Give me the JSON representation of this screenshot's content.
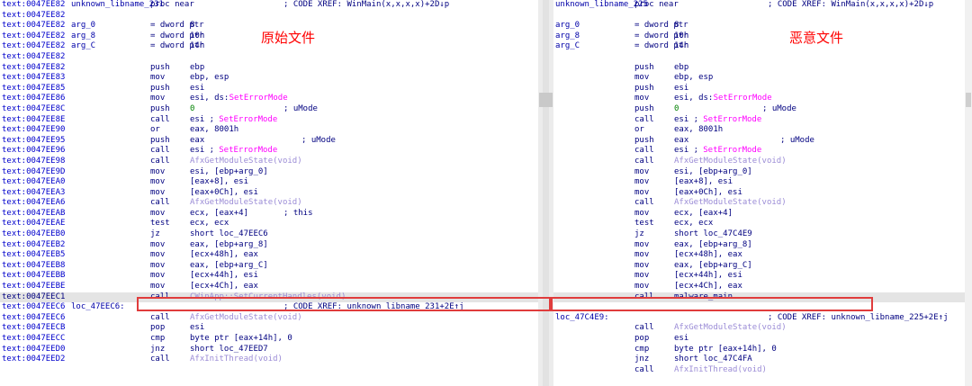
{
  "labels": {
    "left_title": "原始文件",
    "right_title": "恶意文件"
  },
  "left_lines": [
    {
      "addr": "text:0047EE82",
      "label": "unknown_libname_231",
      "mn": "proc near",
      "cm": "; CODE XREF: WinMain(x,x,x,x)+2D↓p"
    },
    {
      "addr": "text:0047EE82"
    },
    {
      "addr": "text:0047EE82",
      "label": "arg_0",
      "mn": "= dword ptr",
      "op": "8"
    },
    {
      "addr": "text:0047EE82",
      "label": "arg_8",
      "mn": "= dword ptr",
      "op": "10h"
    },
    {
      "addr": "text:0047EE82",
      "label": "arg_C",
      "mn": "= dword ptr",
      "op": "14h"
    },
    {
      "addr": "text:0047EE82"
    },
    {
      "addr": "text:0047EE82",
      "mn": "push",
      "op": "ebp"
    },
    {
      "addr": "text:0047EE83",
      "mn": "mov",
      "op": "ebp, esp"
    },
    {
      "addr": "text:0047EE85",
      "mn": "push",
      "op": "esi"
    },
    {
      "addr": "text:0047EE86",
      "mn": "mov",
      "op": "esi, ds:",
      "sym": "SetErrorMode"
    },
    {
      "addr": "text:0047EE8C",
      "mn": "push",
      "num": "0",
      "cm": "; uMode"
    },
    {
      "addr": "text:0047EE8E",
      "mn": "call",
      "op": "esi ;",
      "sym": "SetErrorMode"
    },
    {
      "addr": "text:0047EE90",
      "mn": "or",
      "op": "eax, 8001h"
    },
    {
      "addr": "text:0047EE95",
      "mn": "push",
      "op": "eax",
      "cm": "; uMode"
    },
    {
      "addr": "text:0047EE96",
      "mn": "call",
      "op": "esi ;",
      "sym": "SetErrorMode"
    },
    {
      "addr": "text:0047EE98",
      "mn": "call",
      "fn": "AfxGetModuleState(void)"
    },
    {
      "addr": "text:0047EE9D",
      "mn": "mov",
      "op": "esi, [ebp+arg_0]"
    },
    {
      "addr": "text:0047EEA0",
      "mn": "mov",
      "op": "[eax+8], esi"
    },
    {
      "addr": "text:0047EEA3",
      "mn": "mov",
      "op": "[eax+0Ch], esi"
    },
    {
      "addr": "text:0047EEA6",
      "mn": "call",
      "fn": "AfxGetModuleState(void)"
    },
    {
      "addr": "text:0047EEAB",
      "mn": "mov",
      "op": "ecx, [eax+4]",
      "cm": "; this"
    },
    {
      "addr": "text:0047EEAE",
      "mn": "test",
      "op": "ecx, ecx"
    },
    {
      "addr": "text:0047EEB0",
      "mn": "jz",
      "op": "short loc_47EEC6"
    },
    {
      "addr": "text:0047EEB2",
      "mn": "mov",
      "op": "eax, [ebp+arg_8]"
    },
    {
      "addr": "text:0047EEB5",
      "mn": "mov",
      "op": "[ecx+48h], eax"
    },
    {
      "addr": "text:0047EEB8",
      "mn": "mov",
      "op": "eax, [ebp+arg_C]"
    },
    {
      "addr": "text:0047EEBB",
      "mn": "mov",
      "op": "[ecx+44h], esi"
    },
    {
      "addr": "text:0047EEBE",
      "mn": "mov",
      "op": "[ecx+4Ch], eax"
    },
    {
      "addr": "text:0047EEC1",
      "mn": "call",
      "fn": "CWinApp::SetCurrentHandles(void)",
      "hl": true
    },
    {
      "addr": "text:0047EEC6",
      "label": "loc_47EEC6:",
      "cm": "; CODE XREF: unknown_libname_231+2E↑j"
    },
    {
      "addr": "text:0047EEC6",
      "mn": "call",
      "fn": "AfxGetModuleState(void)"
    },
    {
      "addr": "text:0047EECB",
      "mn": "pop",
      "op": "esi"
    },
    {
      "addr": "text:0047EECC",
      "mn": "cmp",
      "op": "byte ptr [eax+14h], 0"
    },
    {
      "addr": "text:0047EED0",
      "mn": "jnz",
      "op": "short loc_47EED7"
    },
    {
      "addr": "text:0047EED2",
      "mn": "call",
      "fn": "AfxInitThread(void)"
    }
  ],
  "right_lines": [
    {
      "label": "unknown_libname_225",
      "mn": "proc near",
      "cm": "; CODE XREF: WinMain(x,x,x,x)+2D↓p"
    },
    {},
    {
      "label": "arg_0",
      "mn": "= dword ptr",
      "op": "8"
    },
    {
      "label": "arg_8",
      "mn": "= dword ptr",
      "op": "10h"
    },
    {
      "label": "arg_C",
      "mn": "= dword ptr",
      "op": "14h"
    },
    {},
    {
      "mn": "push",
      "op": "ebp"
    },
    {
      "mn": "mov",
      "op": "ebp, esp"
    },
    {
      "mn": "push",
      "op": "esi"
    },
    {
      "mn": "mov",
      "op": "esi, ds:",
      "sym": "SetErrorMode"
    },
    {
      "mn": "push",
      "num": "0",
      "cm": "; uMode"
    },
    {
      "mn": "call",
      "op": "esi ;",
      "sym": "SetErrorMode"
    },
    {
      "mn": "or",
      "op": "eax, 8001h"
    },
    {
      "mn": "push",
      "op": "eax",
      "cm": "; uMode"
    },
    {
      "mn": "call",
      "op": "esi ;",
      "sym": "SetErrorMode"
    },
    {
      "mn": "call",
      "fn": "AfxGetModuleState(void)"
    },
    {
      "mn": "mov",
      "op": "esi, [ebp+arg_0]"
    },
    {
      "mn": "mov",
      "op": "[eax+8], esi"
    },
    {
      "mn": "mov",
      "op": "[eax+0Ch], esi"
    },
    {
      "mn": "call",
      "fn": "AfxGetModuleState(void)"
    },
    {
      "mn": "mov",
      "op": "ecx, [eax+4]"
    },
    {
      "mn": "test",
      "op": "ecx, ecx"
    },
    {
      "mn": "jz",
      "op": "short loc_47C4E9"
    },
    {
      "mn": "mov",
      "op": "eax, [ebp+arg_8]"
    },
    {
      "mn": "mov",
      "op": "[ecx+48h], eax"
    },
    {
      "mn": "mov",
      "op": "eax, [ebp+arg_C]"
    },
    {
      "mn": "mov",
      "op": "[ecx+44h], esi"
    },
    {
      "mn": "mov",
      "op": "[ecx+4Ch], eax"
    },
    {
      "mn": "call",
      "op": "malware_main",
      "hl": true
    },
    {},
    {
      "label": "loc_47C4E9:",
      "cm": "; CODE XREF: unknown_libname_225+2E↑j"
    },
    {
      "mn": "call",
      "fn": "AfxGetModuleState(void)"
    },
    {
      "mn": "pop",
      "op": "esi"
    },
    {
      "mn": "cmp",
      "op": "byte ptr [eax+14h], 0"
    },
    {
      "mn": "jnz",
      "op": "short loc_47C4FA"
    },
    {
      "mn": "call",
      "fn": "AfxInitThread(void)"
    }
  ]
}
